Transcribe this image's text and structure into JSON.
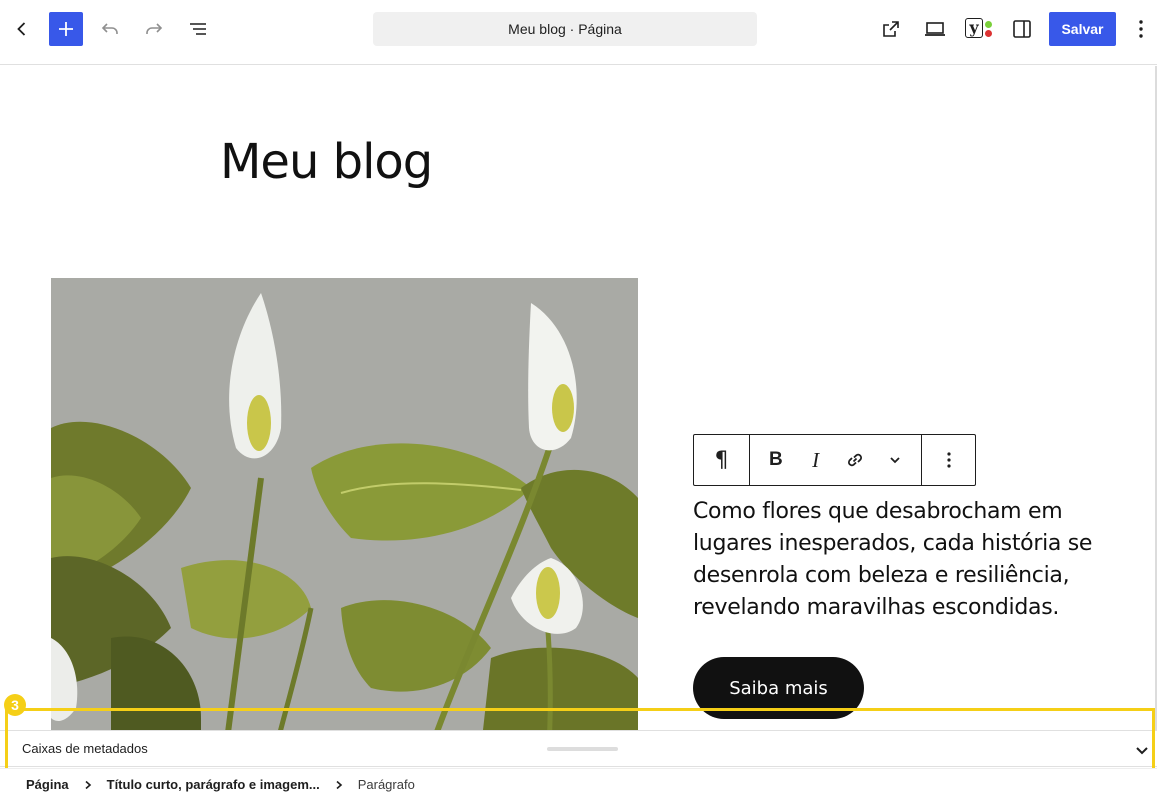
{
  "header": {
    "back_icon": "chevron-left-icon",
    "add_icon": "plus-icon",
    "undo_icon": "undo-icon",
    "redo_icon": "redo-icon",
    "list_view_icon": "list-view-icon",
    "doc_title": "Meu blog · Página",
    "view_icon": "external-link-icon",
    "preview_icon": "desktop-icon",
    "seo_icon": "yoast-icon",
    "settings_icon": "sidebar-icon",
    "save_label": "Salvar",
    "options_icon": "more-vertical-icon",
    "accent": "#3858e9"
  },
  "content": {
    "site_title": "Meu blog",
    "image_description_icon": "flower-image",
    "paragraph": "Como flores que desabrocham em lugares inesperados, cada história se desenrola com beleza e resiliência, revelando maravilhas escondidas.",
    "button_label": "Saiba mais"
  },
  "block_toolbar": {
    "paragraph_icon": "¶",
    "bold_label": "B",
    "italic_label": "I",
    "link_icon": "link-icon",
    "more_icon": "chevron-down-icon",
    "options_icon": "more-vertical-icon"
  },
  "metaboxes": {
    "label": "Caixas de metadados",
    "toggle_icon": "chevron-down-icon",
    "highlight_number": "3",
    "highlight_color": "#f5cf17"
  },
  "breadcrumb": {
    "items": [
      "Página",
      "Título curto, parágrafo e imagem...",
      "Parágrafo"
    ]
  }
}
